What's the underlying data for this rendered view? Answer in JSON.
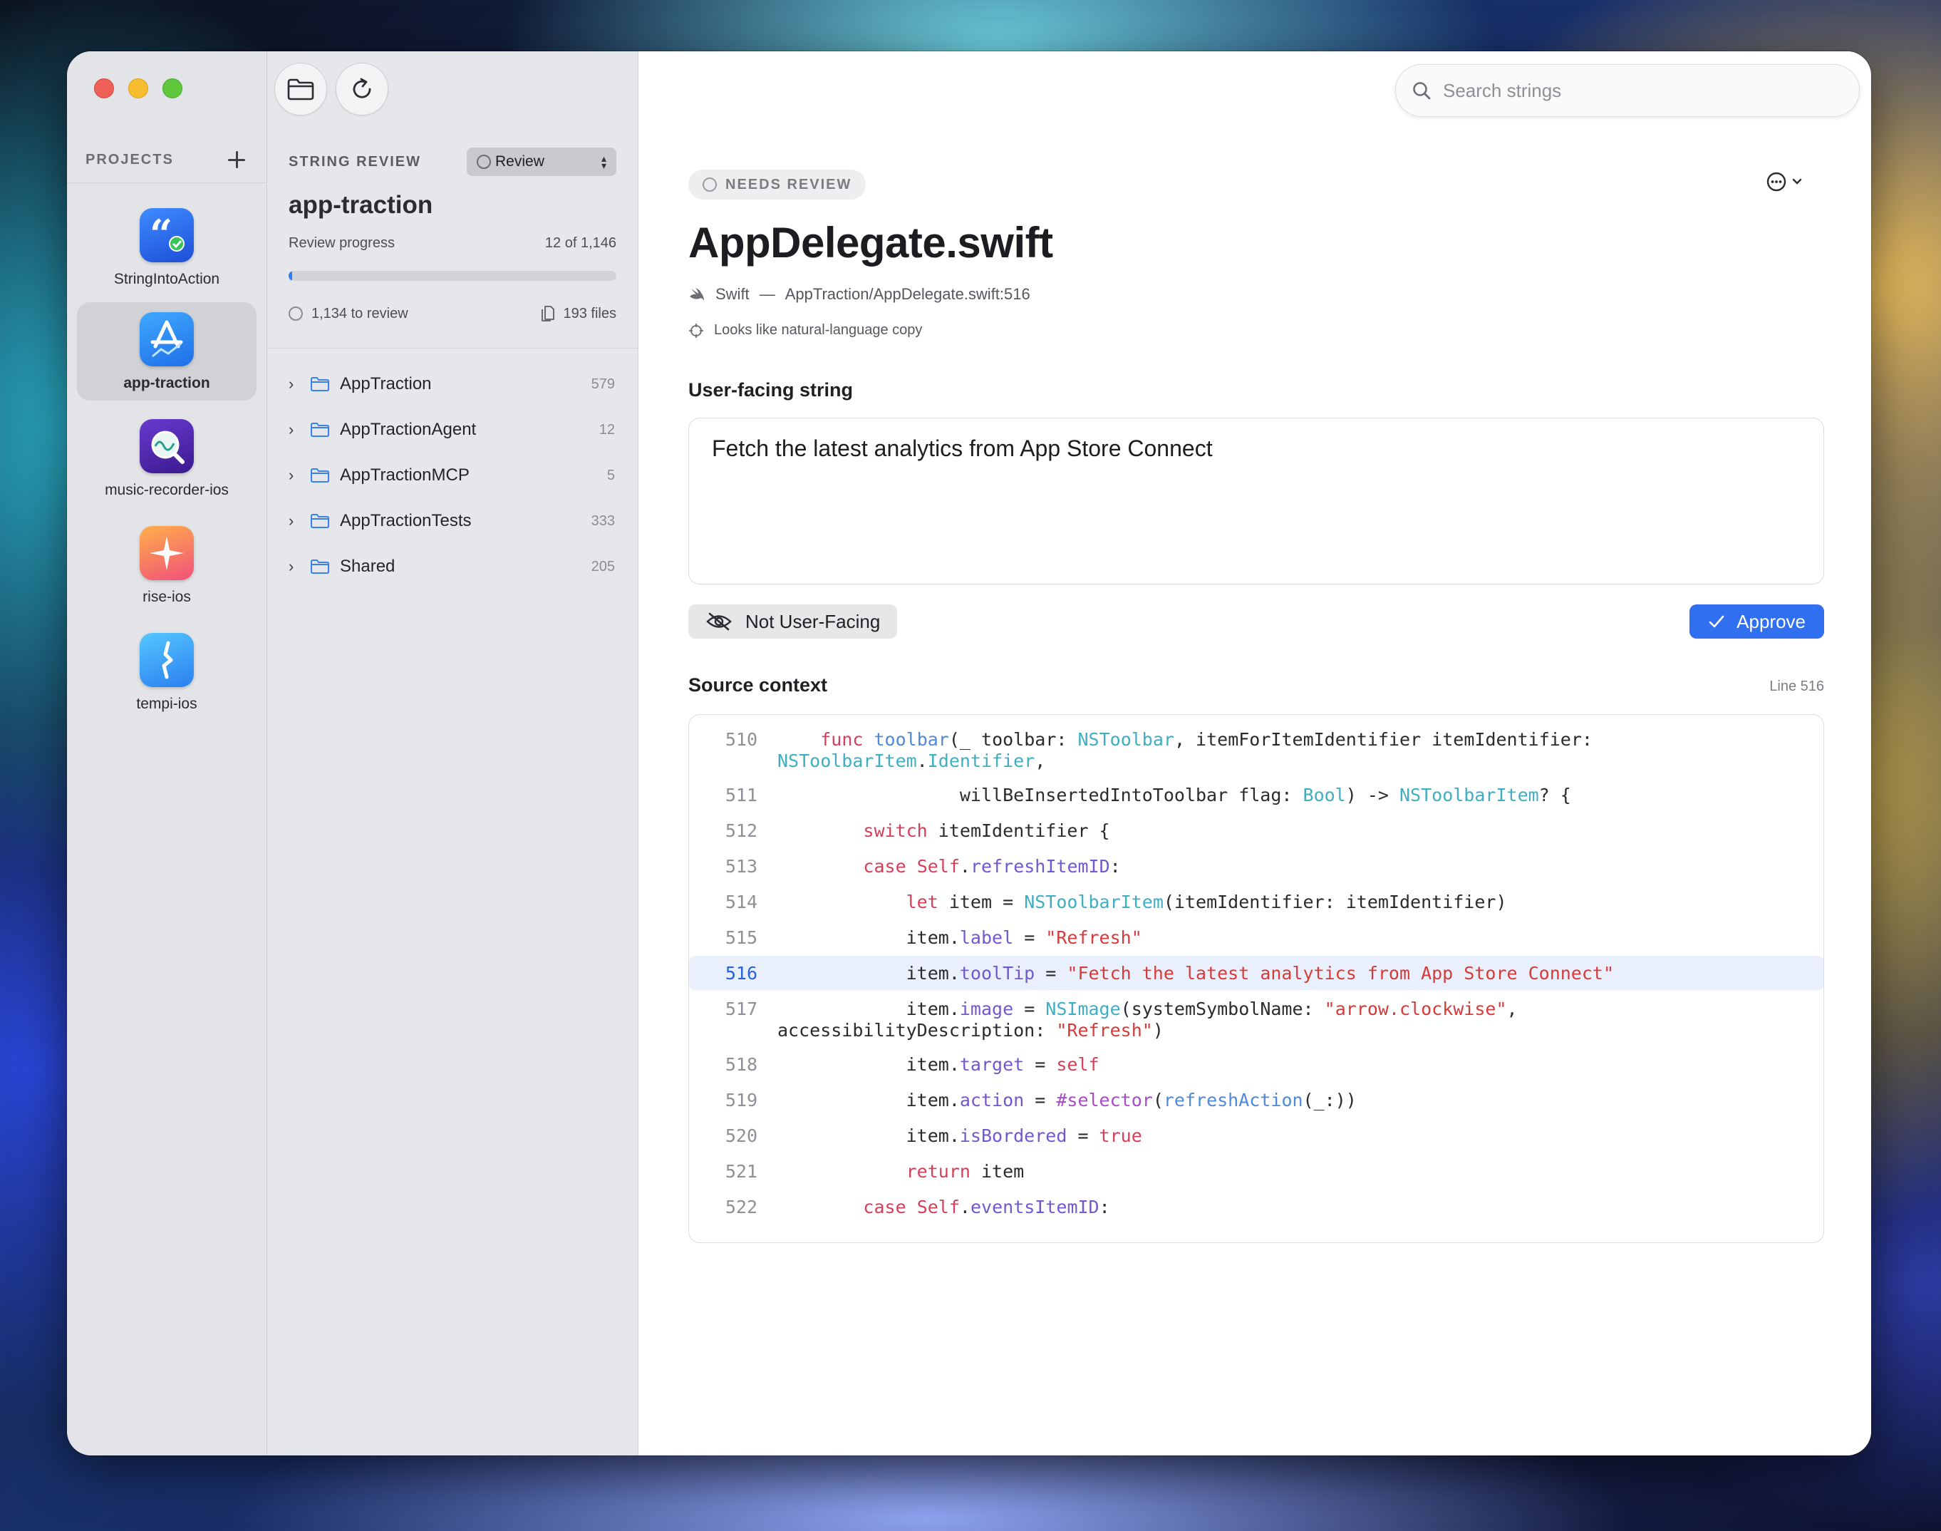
{
  "sidebar": {
    "title": "PROJECTS",
    "projects": [
      {
        "name": "StringIntoAction",
        "icon": "quote-bubble-icon",
        "active": false
      },
      {
        "name": "app-traction",
        "icon": "app-store-chart-icon",
        "active": true
      },
      {
        "name": "music-recorder-ios",
        "icon": "waveform-magnifier-icon",
        "active": false
      },
      {
        "name": "rise-ios",
        "icon": "sparkle-star-icon",
        "active": false
      },
      {
        "name": "tempi-ios",
        "icon": "metronome-icon",
        "active": false
      }
    ]
  },
  "middle": {
    "section_title": "STRING REVIEW",
    "filter": {
      "selected": "Review"
    },
    "project_name": "app-traction",
    "progress_label": "Review progress",
    "progress_text": "12 of 1,146",
    "progress_fraction": 0.0105,
    "to_review": "1,134 to review",
    "files": "193 files",
    "folders": [
      {
        "name": "AppTraction",
        "count": "579"
      },
      {
        "name": "AppTractionAgent",
        "count": "12"
      },
      {
        "name": "AppTractionMCP",
        "count": "5"
      },
      {
        "name": "AppTractionTests",
        "count": "333"
      },
      {
        "name": "Shared",
        "count": "205"
      }
    ]
  },
  "main": {
    "search": {
      "placeholder": "Search strings",
      "value": ""
    },
    "status": "NEEDS REVIEW",
    "file_title": "AppDelegate.swift",
    "language": "Swift",
    "dash": "—",
    "path": "AppTraction/AppDelegate.swift:516",
    "classification": "Looks like natural-language copy",
    "string_heading": "User-facing string",
    "string_value": "Fetch the latest analytics from App Store Connect",
    "not_user_facing_label": "Not User-Facing",
    "approve_label": "Approve",
    "context_heading": "Source context",
    "line_ref": "Line 516",
    "highlight_line": 516,
    "code_lines": [
      {
        "n": "510",
        "html": "    <span class=\"kw\">func</span> <span class=\"fn\">toolbar</span>(_ toolbar: <span class=\"ty\">NSToolbar</span>, itemForItemIdentifier itemIdentifier:\n<span class=\"ty\">NSToolbarItem</span>.<span class=\"ty\">Identifier</span>,"
      },
      {
        "n": "511",
        "html": "                 willBeInsertedIntoToolbar flag: <span class=\"ty\">Bool</span>) -> <span class=\"ty\">NSToolbarItem</span>? {"
      },
      {
        "n": "512",
        "html": "        <span class=\"kw\">switch</span> itemIdentifier {"
      },
      {
        "n": "513",
        "html": "        <span class=\"kw\">case</span> <span class=\"kw\">Self</span>.<span class=\"pr\">refreshItemID</span>:"
      },
      {
        "n": "514",
        "html": "            <span class=\"kw\">let</span> item = <span class=\"ty\">NSToolbarItem</span>(itemIdentifier: itemIdentifier)"
      },
      {
        "n": "515",
        "html": "            item.<span class=\"pr\">label</span> = <span class=\"st\">\"Refresh\"</span>"
      },
      {
        "n": "516",
        "html": "            item.<span class=\"pr\">toolTip</span> = <span class=\"st\">\"Fetch the latest analytics from App Store Connect\"</span>"
      },
      {
        "n": "517",
        "html": "            item.<span class=\"pr\">image</span> = <span class=\"ty\">NSImage</span>(systemSymbolName: <span class=\"st\">\"arrow.clockwise\"</span>,\naccessibilityDescription: <span class=\"st\">\"Refresh\"</span>)"
      },
      {
        "n": "518",
        "html": "            item.<span class=\"pr\">target</span> = <span class=\"kw\">self</span>"
      },
      {
        "n": "519",
        "html": "            item.<span class=\"pr\">action</span> = <span class=\"at\">#selector</span>(<span class=\"fn\">refreshAction</span>(_:))"
      },
      {
        "n": "520",
        "html": "            item.<span class=\"pr\">isBordered</span> = <span class=\"kw\">true</span>"
      },
      {
        "n": "521",
        "html": "            <span class=\"kw\">return</span> item"
      },
      {
        "n": "522",
        "html": "        <span class=\"kw\">case</span> <span class=\"kw\">Self</span>.<span class=\"pr\">eventsItemID</span>:"
      }
    ]
  },
  "colors": {
    "accent": "#2f6ff0",
    "highlight_bg": "#eaf0fb",
    "keyword": "#d4405a",
    "type": "#3faec2",
    "string": "#d63b3b"
  }
}
